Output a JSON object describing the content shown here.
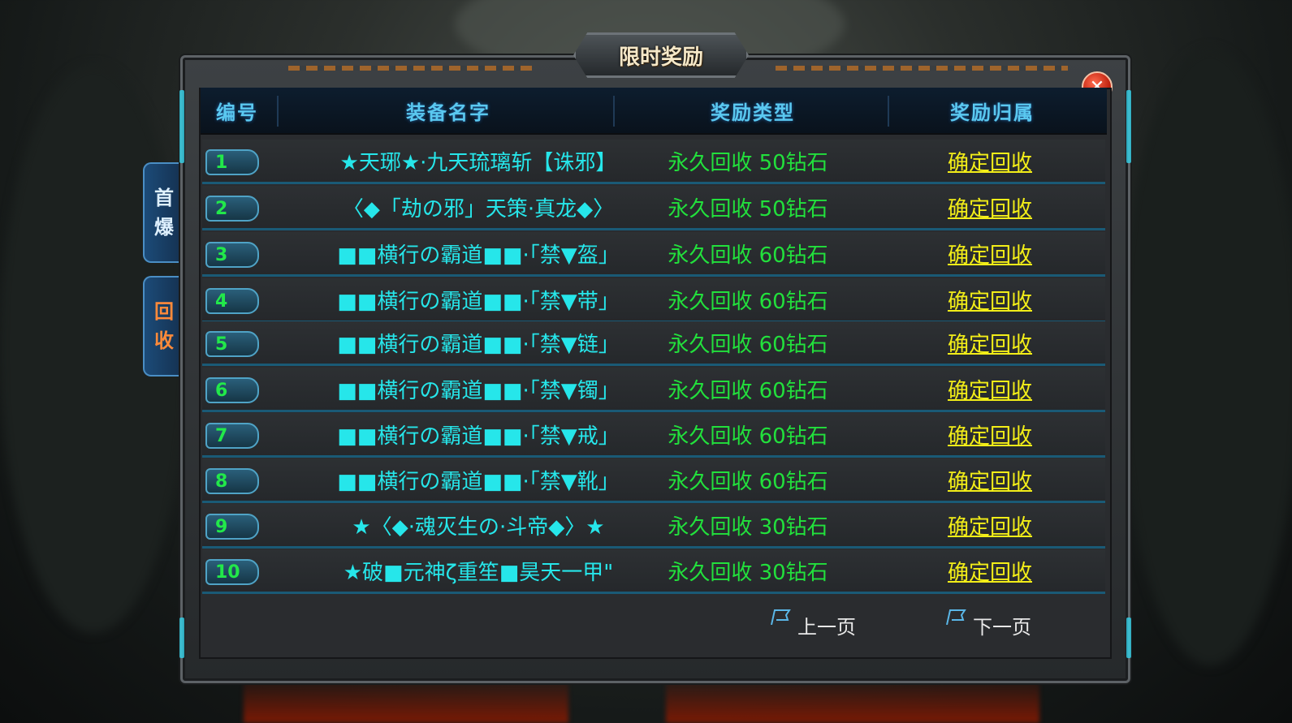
{
  "window": {
    "title": "限时奖励",
    "close_label": "✕"
  },
  "side_tabs": [
    {
      "chars": [
        "首",
        "爆"
      ],
      "color": "#dff1ff"
    },
    {
      "chars": [
        "回",
        "收"
      ],
      "color": "#ff8a3a"
    }
  ],
  "table": {
    "headers": [
      "编号",
      "装备名字",
      "奖励类型",
      "奖励归属"
    ],
    "rows": [
      {
        "num": "1",
        "item": "★天琊★·九天琉璃斩【诛邪】",
        "reward": "永久回收 50钻石",
        "action": "确定回收"
      },
      {
        "num": "2",
        "item": "〈◆「劫の邪」天策·真龙◆〉",
        "reward": "永久回收 50钻石",
        "action": "确定回收"
      },
      {
        "num": "3",
        "item": "■■横行の霸道■■·「禁▼盔」",
        "reward": "永久回收 60钻石",
        "action": "确定回收"
      },
      {
        "num": "4",
        "item": "■■横行の霸道■■·「禁▼带」",
        "reward": "永久回收 60钻石",
        "action": "确定回收"
      },
      {
        "num": "5",
        "item": "■■横行の霸道■■·「禁▼链」",
        "reward": "永久回收 60钻石",
        "action": "确定回收"
      },
      {
        "num": "6",
        "item": "■■横行の霸道■■·「禁▼镯」",
        "reward": "永久回收 60钻石",
        "action": "确定回收"
      },
      {
        "num": "7",
        "item": "■■横行の霸道■■·「禁▼戒」",
        "reward": "永久回收 60钻石",
        "action": "确定回收"
      },
      {
        "num": "8",
        "item": "■■横行の霸道■■·「禁▼靴」",
        "reward": "永久回收 60钻石",
        "action": "确定回收"
      },
      {
        "num": "9",
        "item": "★〈◆·魂灭生の·斗帝◆〉★",
        "reward": "永久回收 30钻石",
        "action": "确定回收"
      },
      {
        "num": "10",
        "item": "★破■元神ζ重笙■昊天一甲\"",
        "reward": "永久回收 30钻石",
        "action": "确定回收"
      }
    ]
  },
  "pager": {
    "prev_label": "上一页",
    "next_label": "下一页"
  },
  "colors": {
    "header_text": "#5ac8f0",
    "item_text": "#26e6ea",
    "reward_text": "#22e03c",
    "action_text": "#f3ee18",
    "number_text": "#22e84a",
    "row_divider": "#1a5a76"
  },
  "icons": [
    "close-icon",
    "flag-icon"
  ]
}
